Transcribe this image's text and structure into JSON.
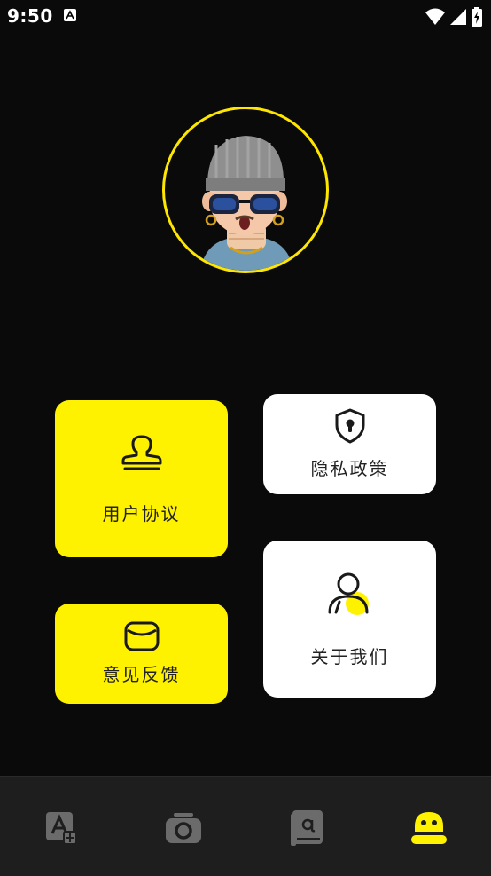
{
  "status_bar": {
    "time": "9:50"
  },
  "cards": {
    "user_agreement": {
      "label": "用户协议"
    },
    "privacy_policy": {
      "label": "隐私政策"
    },
    "feedback": {
      "label": "意见反馈"
    },
    "about_us": {
      "label": "关于我们"
    }
  },
  "icons": {
    "user_agreement": "stamp-icon",
    "privacy_policy": "shield-lock-icon",
    "feedback": "envelope-icon",
    "about_us": "user-icon",
    "nav": [
      "translate-icon",
      "camera-icon",
      "book-icon",
      "profile-icon"
    ]
  },
  "colors": {
    "accent": "#fff200",
    "background": "#0a0a0a",
    "nav_background": "#1e1e1e",
    "nav_inactive": "#6b6b6b"
  },
  "bottom_nav": {
    "active_index": 3
  }
}
